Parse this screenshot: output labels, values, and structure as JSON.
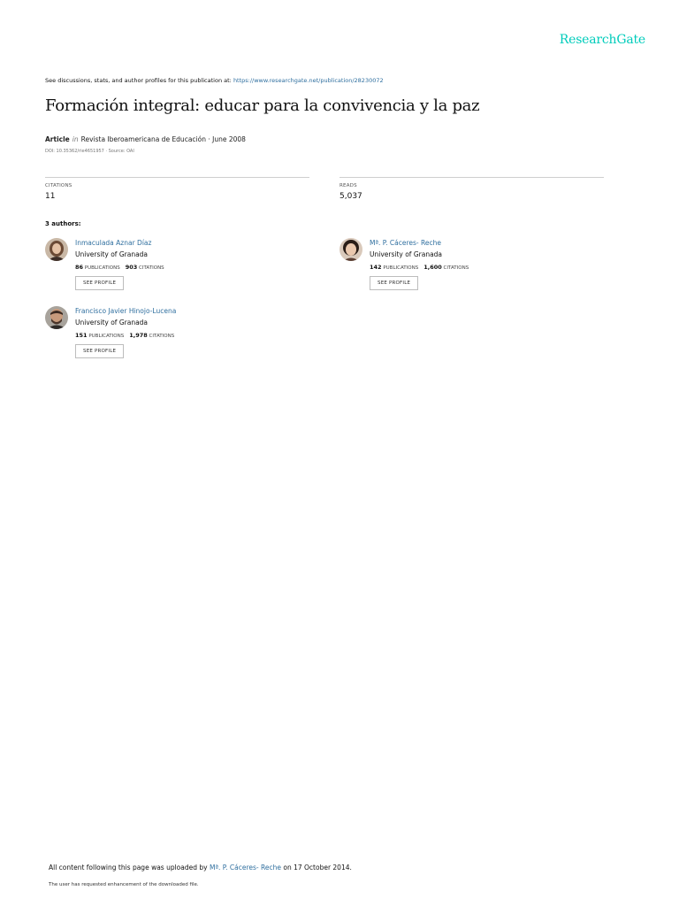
{
  "brand": {
    "name": "ResearchGate",
    "color": "#00ccbb"
  },
  "discussion": {
    "prefix": "See discussions, stats, and author profiles for this publication at: ",
    "url": "https://www.researchgate.net/publication/28230072"
  },
  "article": {
    "title": "Formación integral: educar para la convivencia y la paz",
    "type": "Article",
    "in_word": "in",
    "journal_date": "Revista Iberoamericana de Educación · June 2008",
    "doi_source": "DOI: 10.35362/rie4651957 · Source: OAI"
  },
  "stats": {
    "citations_label": "CITATIONS",
    "citations_value": "11",
    "reads_label": "READS",
    "reads_value": "5,037"
  },
  "authors_heading": "3 authors:",
  "authors": [
    {
      "name": "Inmaculada Aznar Díaz",
      "institution": "University of Granada",
      "publications": "86",
      "publications_label": "PUBLICATIONS",
      "citations": "903",
      "citations_label": "CITATIONS",
      "button": "SEE PROFILE"
    },
    {
      "name": "Mª. P. Cáceres- Reche",
      "institution": "University of Granada",
      "publications": "142",
      "publications_label": "PUBLICATIONS",
      "citations": "1,600",
      "citations_label": "CITATIONS",
      "button": "SEE PROFILE"
    },
    {
      "name": "Francisco Javier Hinojo-Lucena",
      "institution": "University of Granada",
      "publications": "151",
      "publications_label": "PUBLICATIONS",
      "citations": "1,978",
      "citations_label": "CITATIONS",
      "button": "SEE PROFILE"
    }
  ],
  "footer": {
    "upload_prefix": "All content following this page was uploaded by ",
    "uploader": "Mª. P. Cáceres- Reche",
    "upload_suffix": " on 17 October 2014.",
    "note": "The user has requested enhancement of the downloaded file."
  },
  "colors": {
    "link": "#2f6f9f",
    "text": "#111111",
    "rule": "#cfcfcf"
  }
}
